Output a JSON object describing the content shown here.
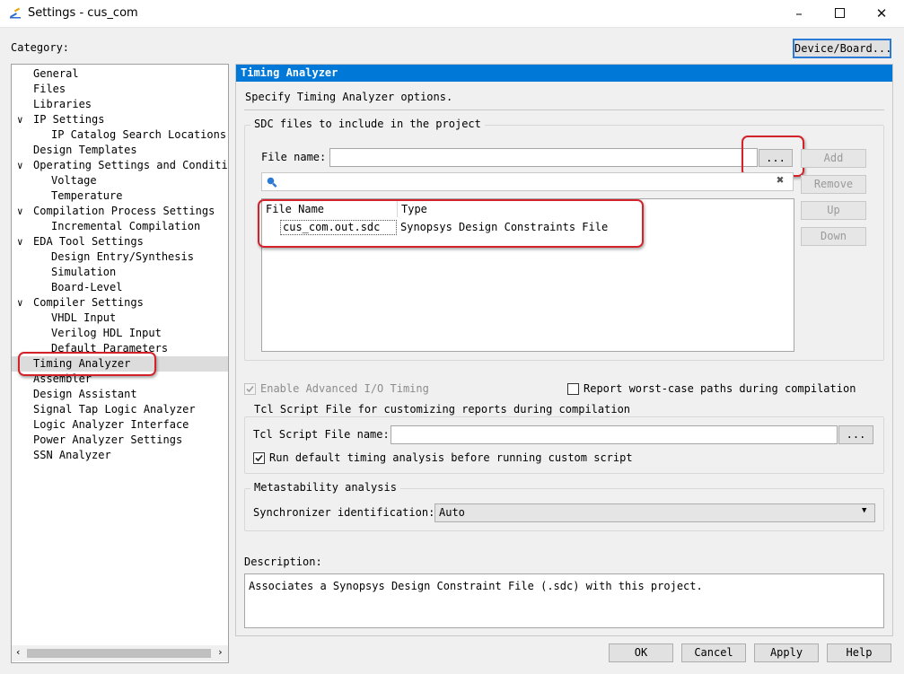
{
  "window": {
    "title": "Settings - cus_com"
  },
  "category_label": "Category:",
  "device_board_button": "Device/Board...",
  "tree": [
    {
      "label": "General",
      "level": 0,
      "chevron": ""
    },
    {
      "label": "Files",
      "level": 0,
      "chevron": ""
    },
    {
      "label": "Libraries",
      "level": 0,
      "chevron": ""
    },
    {
      "label": "IP Settings",
      "level": 0,
      "chevron": "v"
    },
    {
      "label": "IP Catalog Search Locations",
      "level": 1,
      "chevron": ""
    },
    {
      "label": "Design Templates",
      "level": 0,
      "chevron": ""
    },
    {
      "label": "Operating Settings and Conditio",
      "level": 0,
      "chevron": "v"
    },
    {
      "label": "Voltage",
      "level": 1,
      "chevron": ""
    },
    {
      "label": "Temperature",
      "level": 1,
      "chevron": ""
    },
    {
      "label": "Compilation Process Settings",
      "level": 0,
      "chevron": "v"
    },
    {
      "label": "Incremental Compilation",
      "level": 1,
      "chevron": ""
    },
    {
      "label": "EDA Tool Settings",
      "level": 0,
      "chevron": "v"
    },
    {
      "label": "Design Entry/Synthesis",
      "level": 1,
      "chevron": ""
    },
    {
      "label": "Simulation",
      "level": 1,
      "chevron": ""
    },
    {
      "label": "Board-Level",
      "level": 1,
      "chevron": ""
    },
    {
      "label": "Compiler Settings",
      "level": 0,
      "chevron": "v"
    },
    {
      "label": "VHDL Input",
      "level": 1,
      "chevron": ""
    },
    {
      "label": "Verilog HDL Input",
      "level": 1,
      "chevron": ""
    },
    {
      "label": "Default Parameters",
      "level": 1,
      "chevron": ""
    },
    {
      "label": "Timing Analyzer",
      "level": 0,
      "chevron": "",
      "selected": true
    },
    {
      "label": "Assembler",
      "level": 0,
      "chevron": ""
    },
    {
      "label": "Design Assistant",
      "level": 0,
      "chevron": ""
    },
    {
      "label": "Signal Tap Logic Analyzer",
      "level": 0,
      "chevron": ""
    },
    {
      "label": "Logic Analyzer Interface",
      "level": 0,
      "chevron": ""
    },
    {
      "label": "Power Analyzer Settings",
      "level": 0,
      "chevron": ""
    },
    {
      "label": "SSN Analyzer",
      "level": 0,
      "chevron": ""
    }
  ],
  "panel": {
    "header": "Timing Analyzer",
    "header_color": "#0078d7",
    "intro": "Specify Timing Analyzer options.",
    "sdc": {
      "group_title": "SDC files to include in the project",
      "file_name_label": "File name:",
      "file_name_value": "",
      "browse_label": "...",
      "search_value": "",
      "columns": [
        "File Name",
        "Type"
      ],
      "rows": [
        {
          "file": "cus_com.out.sdc",
          "type": "Synopsys Design Constraints File"
        }
      ],
      "buttons": {
        "add": "Add",
        "remove": "Remove",
        "up": "Up",
        "down": "Down"
      }
    },
    "enable_advanced_io": {
      "label": "Enable Advanced I/O Timing",
      "checked": true,
      "enabled": false
    },
    "report_worst_case": {
      "label": "Report worst-case paths during compilation",
      "checked": false
    },
    "tcl": {
      "group_title": "Tcl Script File for customizing reports during compilation",
      "file_label": "Tcl Script File name:",
      "file_value": "",
      "browse_label": "...",
      "run_default": {
        "label": "Run default timing analysis before running custom script",
        "checked": true
      }
    },
    "metastability": {
      "group_title": "Metastability analysis",
      "sync_label": "Synchronizer identification:",
      "sync_value": "Auto"
    },
    "description_label": "Description:",
    "description_text": "Associates a Synopsys Design Constraint File (.sdc) with this project."
  },
  "footer": {
    "ok": "OK",
    "cancel": "Cancel",
    "apply": "Apply",
    "help": "Help"
  },
  "annotation_color": "#d3222a"
}
